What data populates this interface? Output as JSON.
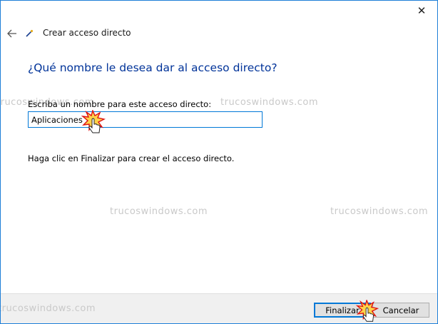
{
  "window": {
    "close_glyph": "✕",
    "back_glyph": "←",
    "title": "Crear acceso directo"
  },
  "main": {
    "question": "¿Qué nombre le desea dar al acceso directo?",
    "field_label": "Escriba un nombre para este acceso directo:",
    "name_value": "Aplicaciones",
    "hint": "Haga clic en Finalizar para crear el acceso directo."
  },
  "watermark": {
    "text": "trucoswindows.com"
  },
  "footer": {
    "finish_label": "Finalizar",
    "cancel_label": "Cancelar"
  },
  "colors": {
    "accent": "#0078d7",
    "question_text": "#003399",
    "watermark": "#c9c9c9",
    "footer_bg": "#f0f0f0"
  },
  "icons": {
    "back": "arrow-left-icon",
    "wizard": "shortcut-wizard-icon",
    "close": "close-icon",
    "cursor": "hand-pointer-cursor-icon"
  }
}
